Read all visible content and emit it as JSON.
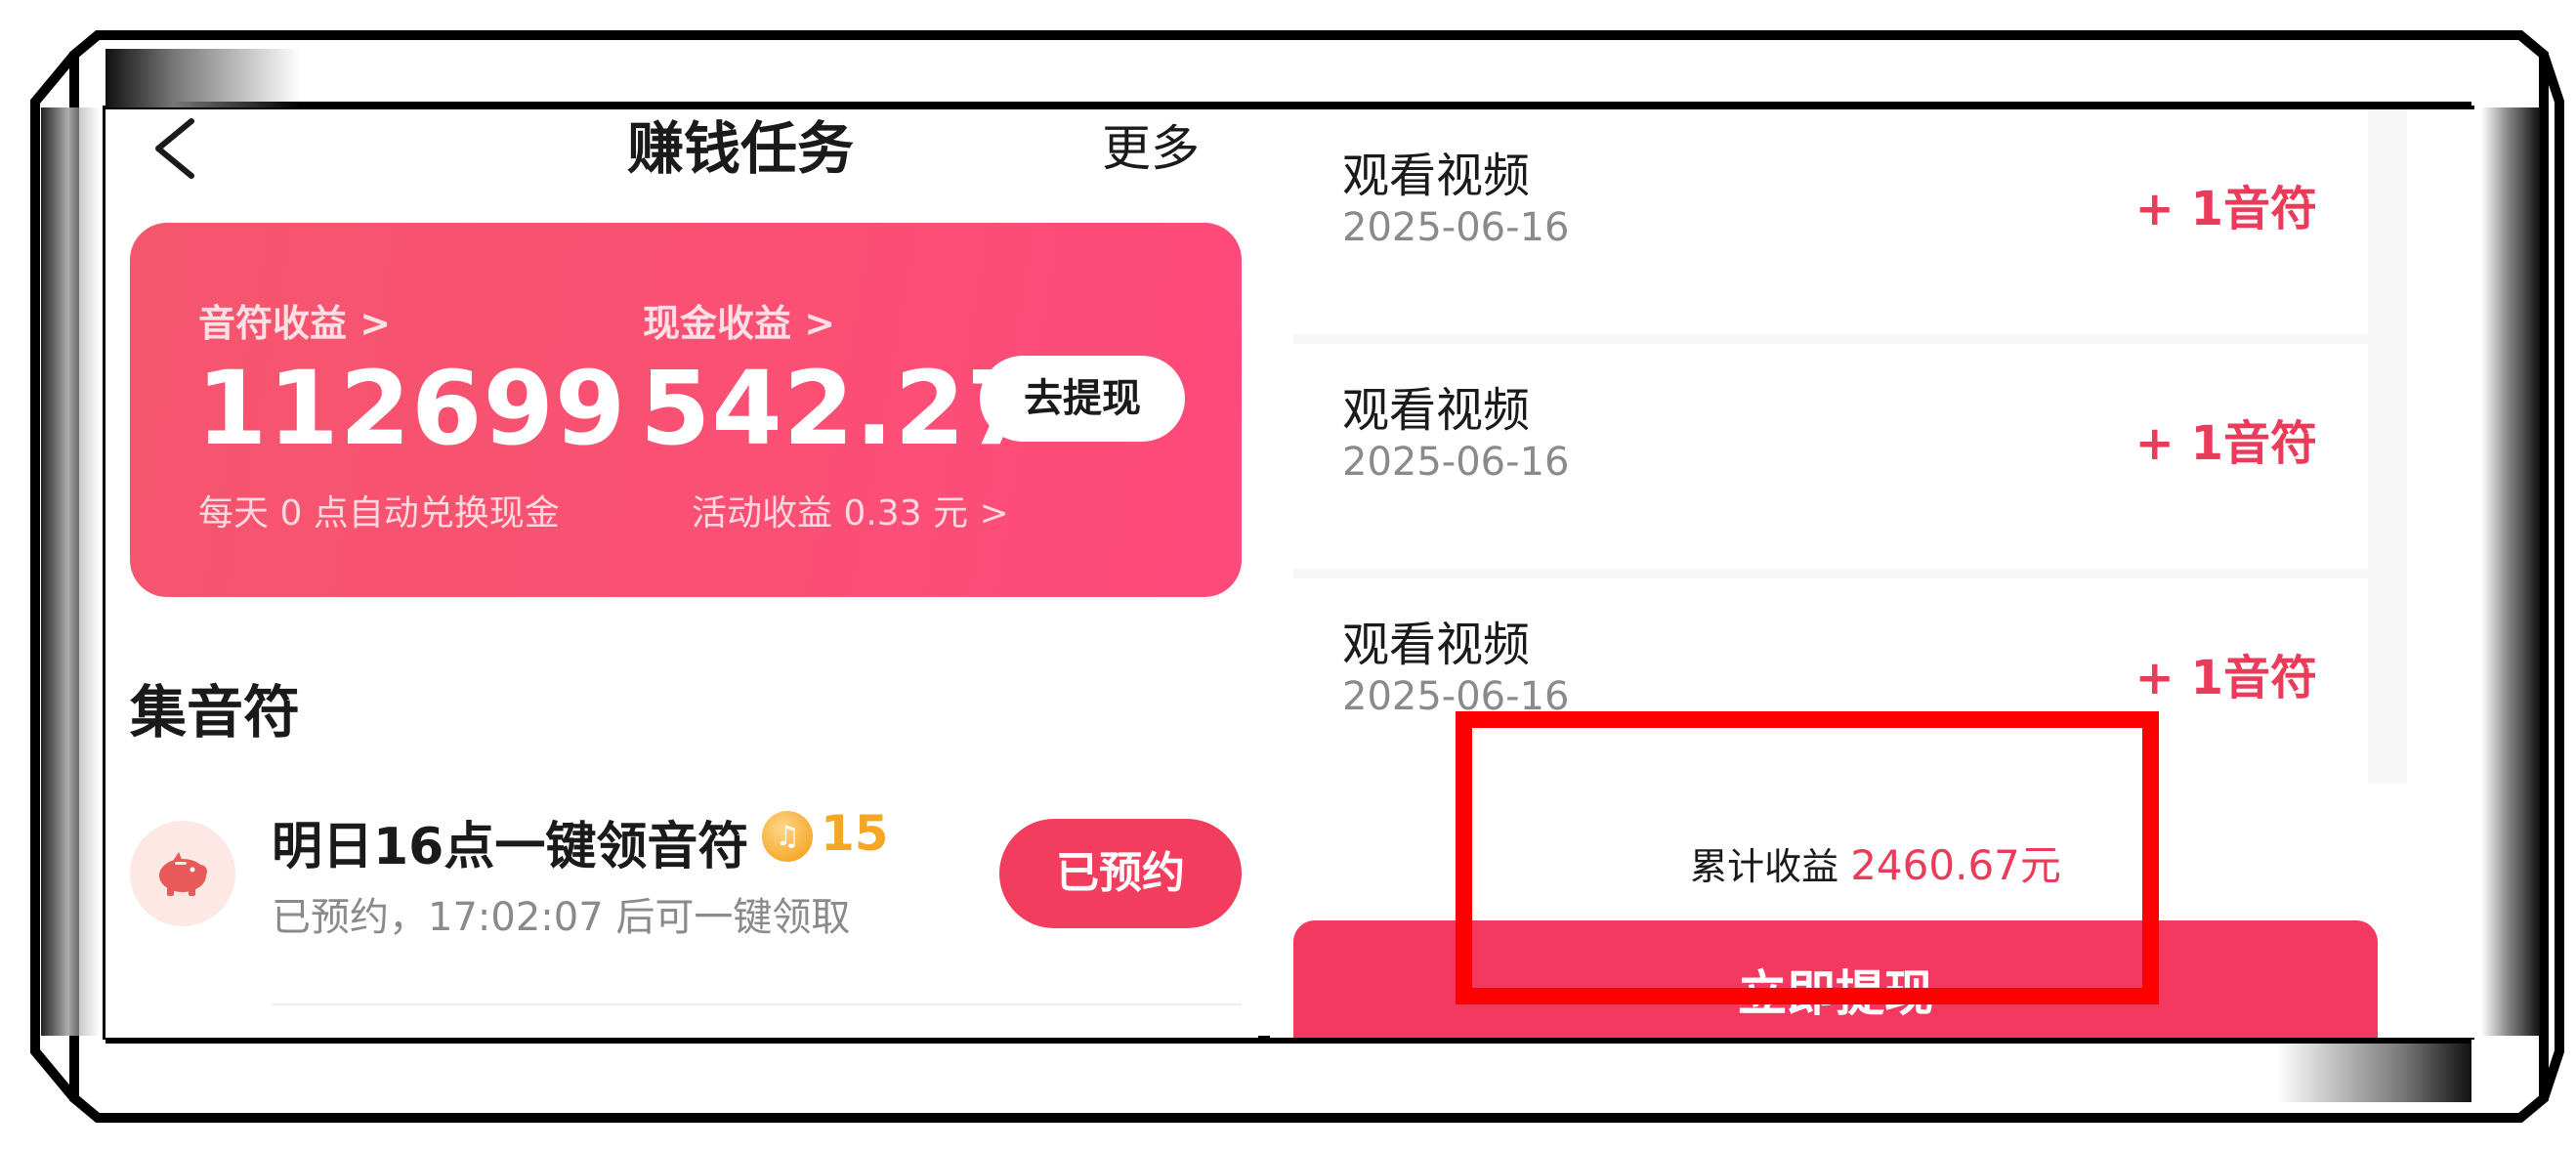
{
  "header": {
    "title": "赚钱任务",
    "more": "更多"
  },
  "earnings_card": {
    "notes_label": "音符收益 >",
    "notes_value": "112699",
    "notes_hint": "每天 0 点自动兑换现金",
    "cash_label": "现金收益 >",
    "cash_value": "542.27",
    "cash_hint": "活动收益 0.33 元 >",
    "withdraw_label": "去提现"
  },
  "section": {
    "title": "集音符",
    "task": {
      "title": "明日16点一键领音符",
      "reward": "15",
      "subtitle": "已预约，17:02:07 后可一键领取",
      "button": "已预约"
    }
  },
  "records": [
    {
      "title": "观看视频",
      "date": "2025-06-16",
      "amount": "+ 1音符"
    },
    {
      "title": "观看视频",
      "date": "2025-06-16",
      "amount": "+ 1音符"
    },
    {
      "title": "观看视频",
      "date": "2025-06-16",
      "amount": "+ 1音符"
    }
  ],
  "summary": {
    "label": "累计收益",
    "amount": "2460.67元",
    "withdraw_button": "立即提现"
  },
  "icons": {
    "back": "chevron-left-icon",
    "pig": "piggy-bank-icon",
    "coin": "music-note-coin-icon"
  },
  "colors": {
    "accent": "#f23d5e",
    "card_gradient_start": "#f4566d",
    "card_gradient_end": "#ff4a7c",
    "reward_gold": "#f5a623",
    "highlight": "#ff0000"
  }
}
